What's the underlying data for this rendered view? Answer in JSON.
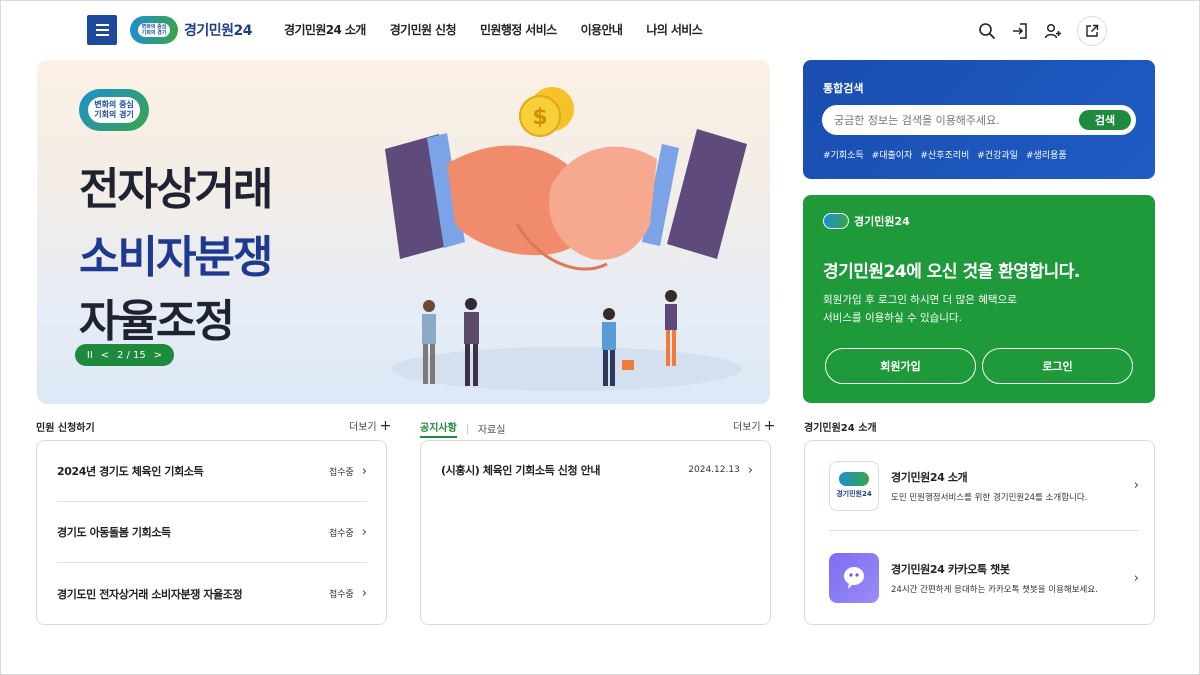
{
  "header": {
    "logo_badge": "변화의 중심\n기회의 경기",
    "logo_text": "경기민원24",
    "nav": [
      "경기민원24 소개",
      "경기민원 신청",
      "민원행정 서비스",
      "이용안내",
      "나의 서비스"
    ],
    "icons": [
      "search-icon",
      "login-icon",
      "user-add-icon",
      "external-link-icon"
    ]
  },
  "banner": {
    "badge": "변화의 중심\n기회의 경기",
    "lines": [
      "전자상거래",
      "소비자분쟁",
      "자율조정"
    ],
    "pager": {
      "pause": "II",
      "prev": "<",
      "page": "2 / 15",
      "next": ">"
    }
  },
  "search": {
    "title": "통합검색",
    "placeholder": "궁금한 정보는 검색을 이용해주세요.",
    "button": "검색",
    "tags": [
      "#기회소득",
      "#대출이자",
      "#산후조리비",
      "#건강과일",
      "#생리용품"
    ]
  },
  "welcome": {
    "brand": "경기민원24",
    "title": "경기민원24에 오신 것을 환영합니다.",
    "desc": "회원가입 후 로그인 하시면 더 많은 혜택으로\n서비스를 이용하실 수 있습니다.",
    "signup": "회원가입",
    "login": "로그인"
  },
  "apply": {
    "title": "민원 신청하기",
    "more": "더보기",
    "items": [
      {
        "name": "2024년 경기도 체육인 기회소득",
        "status": "접수중"
      },
      {
        "name": "경기도 아동돌봄 기회소득",
        "status": "접수중"
      },
      {
        "name": "경기도민 전자상거래 소비자분쟁 자율조정",
        "status": "접수중"
      }
    ]
  },
  "notice": {
    "tab_active": "공지사항",
    "tab_other": "자료실",
    "more": "더보기",
    "items": [
      {
        "title": "(시흥시) 체육인 기회소득 신청 안내",
        "date": "2024.12.13"
      }
    ]
  },
  "intro": {
    "title": "경기민원24 소개",
    "icon_text": "경기민원24",
    "items": [
      {
        "title": "경기민원24 소개",
        "desc": "도민 민원행정서비스를 위한 경기민원24를 소개합니다."
      },
      {
        "title": "경기민원24 카카오톡 챗봇",
        "desc": "24시간 간편하게 응대하는 카카오톡 챗봇을 이용해보세요."
      }
    ]
  },
  "colors": {
    "brand_blue": "#1d4a9c",
    "brand_green": "#1e8a3e",
    "search_bg": "#1a4db0",
    "welcome_bg": "#1e9a3a"
  }
}
